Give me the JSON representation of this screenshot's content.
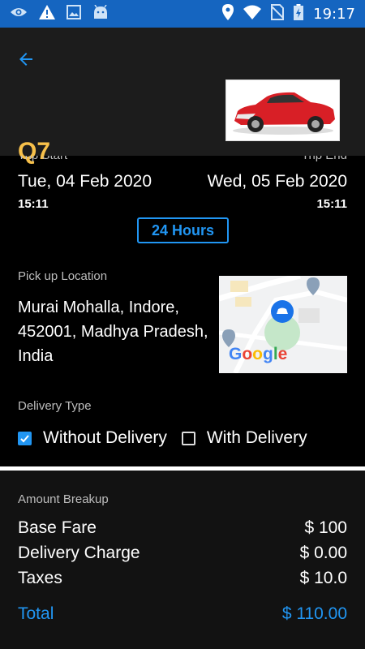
{
  "status_bar": {
    "time": "19:17",
    "left_icons": [
      "eye-icon",
      "warning-icon",
      "image-icon",
      "android-icon"
    ],
    "right_icons": [
      "location-icon",
      "wifi-icon",
      "no-sim-icon",
      "battery-charging-icon"
    ]
  },
  "header": {
    "title": "Q7",
    "back_icon": "arrow-left-icon",
    "image": "red-sedan-car-image"
  },
  "trip": {
    "start_label": "Trip Start",
    "end_label": "Trip End",
    "start_date": "Tue, 04 Feb 2020",
    "start_time": "15:11",
    "end_date": "Wed, 05 Feb 2020",
    "end_time": "15:11",
    "duration": "24 Hours"
  },
  "pickup": {
    "label": "Pick up Location",
    "address": "Murai Mohalla, Indore, 452001, Madhya Pradesh, India",
    "map_logo": "Google"
  },
  "delivery": {
    "label": "Delivery Type",
    "options": [
      {
        "label": "Without Delivery",
        "checked": true
      },
      {
        "label": "With Delivery",
        "checked": false
      }
    ]
  },
  "amount": {
    "label": "Amount Breakup",
    "items": [
      {
        "name": "Base Fare",
        "value": "$ 100"
      },
      {
        "name": "Delivery Charge",
        "value": "$ 0.00"
      },
      {
        "name": "Taxes",
        "value": "$ 10.0"
      }
    ],
    "total_label": "Total",
    "total_value": "$ 110.00"
  },
  "colors": {
    "accent": "#2196f3",
    "title": "#f7c04a",
    "status_bar": "#1565c0"
  }
}
